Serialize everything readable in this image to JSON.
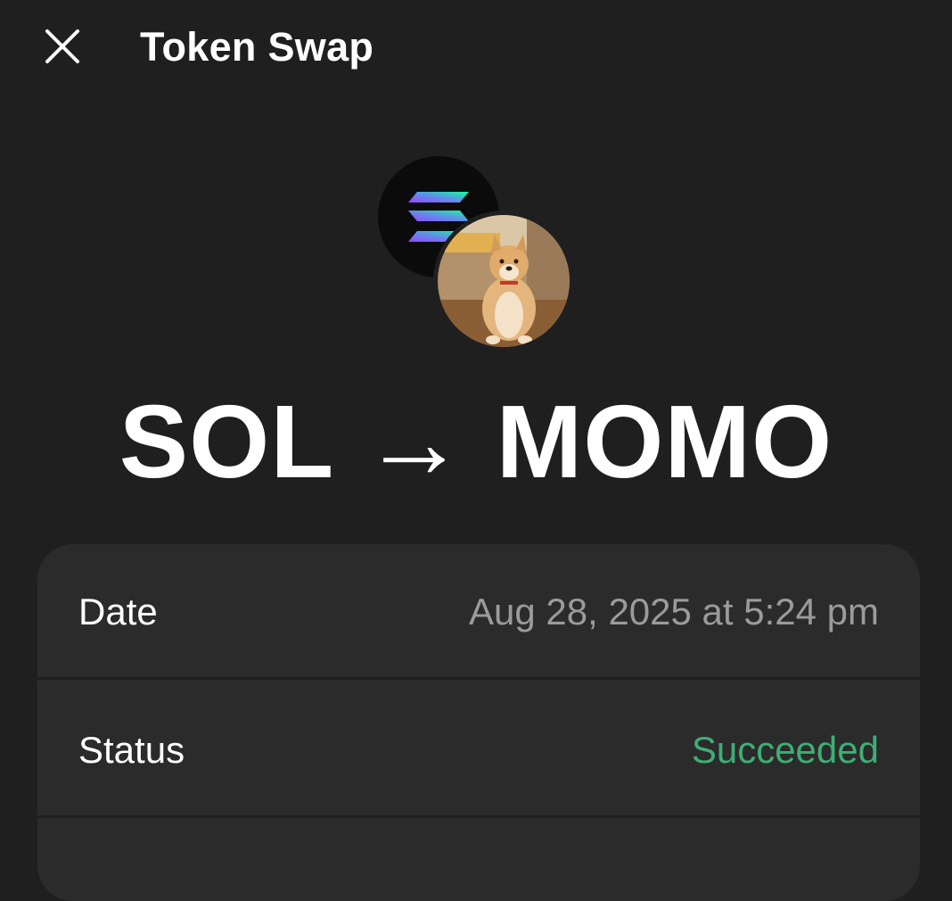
{
  "header": {
    "title": "Token Swap",
    "close_icon": "close-icon"
  },
  "tokens": {
    "from_icon": "solana-logo-icon",
    "to_icon": "momo-dog-avatar"
  },
  "swap": {
    "from": "SOL",
    "arrow": "→",
    "to": "MOMO"
  },
  "details": {
    "rows": [
      {
        "label": "Date",
        "value": "Aug 28, 2025 at 5:24 pm"
      },
      {
        "label": "Status",
        "value": "Succeeded"
      }
    ]
  },
  "colors": {
    "background": "#1f1f1f",
    "card": "#2b2b2b",
    "muted_text": "#9b9b9b",
    "success": "#3fae75"
  }
}
